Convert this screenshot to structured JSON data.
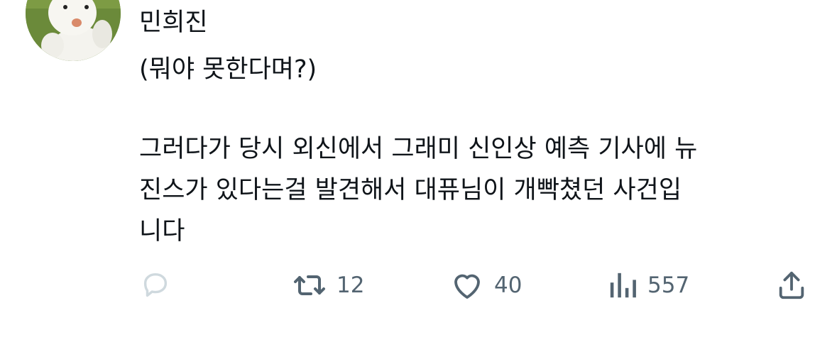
{
  "post": {
    "author_name": "민희진",
    "text_lines": [
      "(뭐야 못한다며?)",
      "그러다가 당시 외신에서 그래미 신인상 예측 기사에 뉴",
      "진스가 있다는걸 발견해서 대퓨님이 개빡쳤던 사건입",
      "니다"
    ]
  },
  "actions": {
    "reply_icon": "reply-icon",
    "retweet_icon": "retweet-icon",
    "retweet_count": "12",
    "like_icon": "heart-icon",
    "like_count": "40",
    "views_icon": "views-icon",
    "views_count": "557",
    "share_icon": "share-icon"
  },
  "colors": {
    "text": "#0f1419",
    "muted": "#536471",
    "reply_faded": "#cfd9de",
    "avatar_bg": "#6b8a3a"
  }
}
